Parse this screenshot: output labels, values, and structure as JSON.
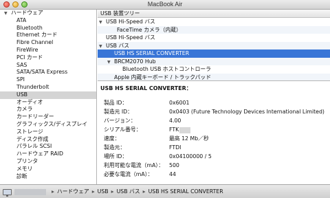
{
  "window": {
    "title": "MacBook Air"
  },
  "sidebar": {
    "root_label": "ハードウェア",
    "items": [
      {
        "label": "ATA"
      },
      {
        "label": "Bluetooth"
      },
      {
        "label": "Ethernet カード"
      },
      {
        "label": "Fibre Channel"
      },
      {
        "label": "FireWire"
      },
      {
        "label": "PCI カード"
      },
      {
        "label": "SAS"
      },
      {
        "label": "SATA/SATA Express"
      },
      {
        "label": "SPI"
      },
      {
        "label": "Thunderbolt"
      },
      {
        "label": "USB",
        "selected": true
      },
      {
        "label": "オーディオ"
      },
      {
        "label": "カメラ"
      },
      {
        "label": "カードリーダー"
      },
      {
        "label": "グラフィックス/ディスプレイ"
      },
      {
        "label": "ストレージ"
      },
      {
        "label": "ディスク作成"
      },
      {
        "label": "パラレル SCSI"
      },
      {
        "label": "ハードウェア RAID"
      },
      {
        "label": "プリンタ"
      },
      {
        "label": "メモリ"
      },
      {
        "label": "診断"
      }
    ]
  },
  "tree": {
    "header": "USB 装置ツリー",
    "rows": [
      {
        "label": "USB Hi-Speed バス",
        "level": 0,
        "expanded": true
      },
      {
        "label": "FaceTime カメラ（内蔵）",
        "level": 2
      },
      {
        "label": "USB Hi-Speed バス",
        "level": 0
      },
      {
        "label": "USB バス",
        "level": 0,
        "expanded": true
      },
      {
        "label": "USB HS SERIAL CONVERTER",
        "level": 1,
        "selected": true
      },
      {
        "label": "BRCM2070 Hub",
        "level": 1,
        "expanded": true
      },
      {
        "label": "Bluetooth USB ホストコントローラ",
        "level": 2
      },
      {
        "label": "Apple 内蔵キーボード / トラックパッド",
        "level": 1
      }
    ]
  },
  "detail": {
    "title": "USB HS SERIAL CONVERTER：",
    "properties": [
      {
        "key": "製品 ID：",
        "value": "0x6001"
      },
      {
        "key": "製造元 ID：",
        "value": "0x0403  (Future Technology Devices International Limited)"
      },
      {
        "key": "バージョン：",
        "value": " 4.00"
      },
      {
        "key": "シリアル番号：",
        "value": "FTK"
      },
      {
        "key": "速度：",
        "value": "最高 12 Mb／秒"
      },
      {
        "key": "製造元：",
        "value": "FTDI"
      },
      {
        "key": "場所 ID：",
        "value": "0x04100000 / 5"
      },
      {
        "key": "利用可能な電流（mA）：",
        "value": "500"
      },
      {
        "key": "必要な電流（mA）：",
        "value": "44"
      }
    ]
  },
  "pathbar": {
    "crumbs": [
      "ハードウェア",
      "USB",
      "USB バス",
      "USB HS SERIAL CONVERTER"
    ],
    "separator": "▸"
  }
}
